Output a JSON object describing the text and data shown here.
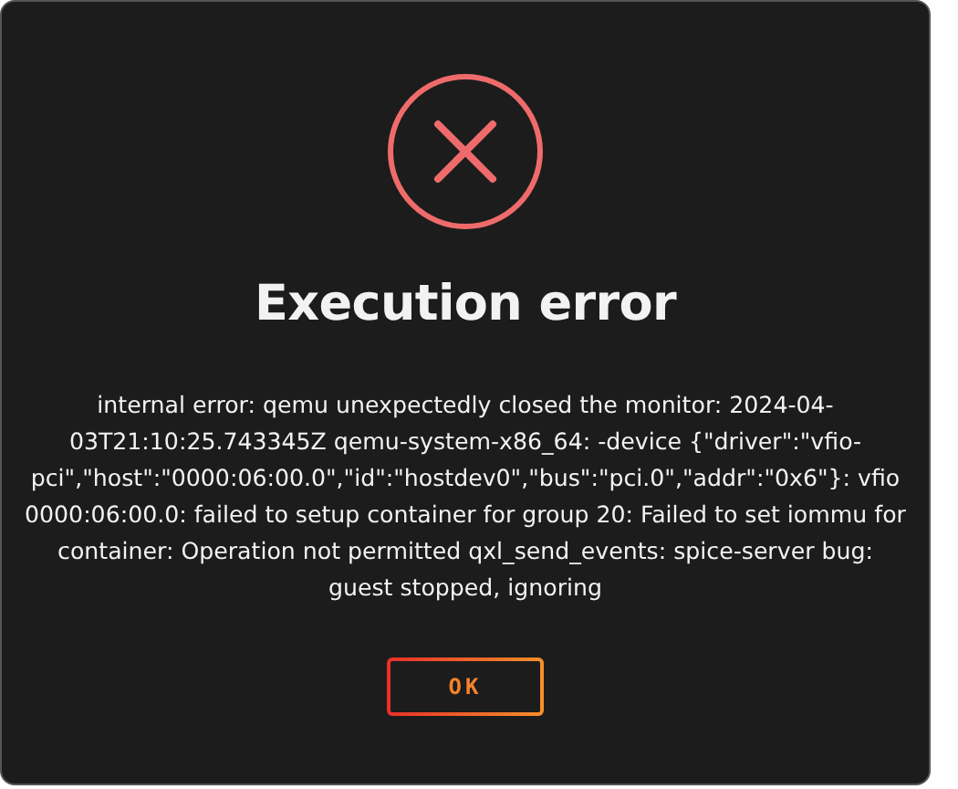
{
  "dialog": {
    "title": "Execution error",
    "message": "internal error: qemu unexpectedly closed the monitor: 2024-04-03T21:10:25.743345Z qemu-system-x86_64: -device {\"driver\":\"vfio-pci\",\"host\":\"0000:06:00.0\",\"id\":\"hostdev0\",\"bus\":\"pci.0\",\"addr\":\"0x6\"}: vfio 0000:06:00.0: failed to setup container for group 20: Failed to set iommu for container: Operation not permitted qxl_send_events: spice-server bug: guest stopped, ignoring",
    "buttons": [
      "OK"
    ]
  }
}
